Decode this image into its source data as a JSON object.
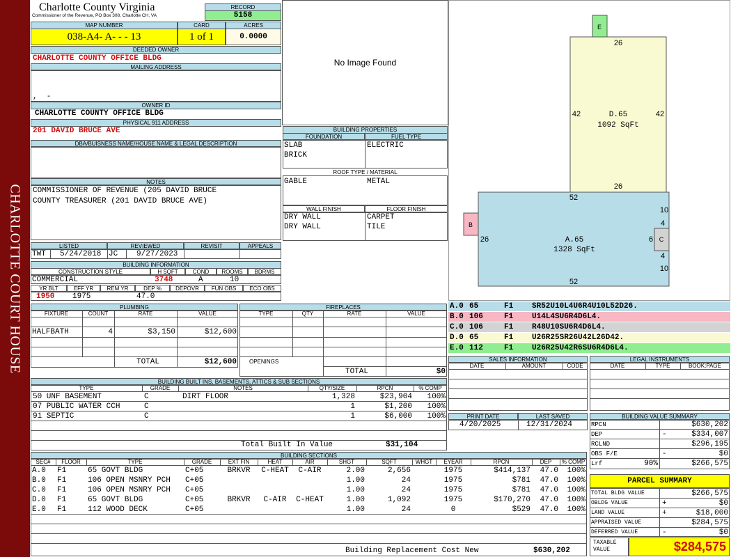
{
  "county": {
    "name": "Charlotte County Virginia",
    "address": "Commissioner of the Revenue, PO Box 308, Charlotte CH, VA",
    "sidebar": "CHARLOTTE COURT HOUSE"
  },
  "record": {
    "label": "RECORD",
    "value": "5158"
  },
  "map": {
    "label": "MAP NUMBER",
    "value": "038-A4- A-  -  - 13"
  },
  "card": {
    "label": "CARD",
    "value": "1 of 1"
  },
  "acres": {
    "label": "ACRES",
    "value": "0.0000"
  },
  "deeded": {
    "label": "DEEDED OWNER",
    "value": "CHARLOTTE COUNTY OFFICE BLDG"
  },
  "mailing": {
    "label": "MAILING ADDRESS",
    "line": ",  -"
  },
  "owner_id": {
    "label": "OWNER ID",
    "value": "CHARLOTTE COUNTY OFFICE BLDG"
  },
  "physical": {
    "label": "PHYSICAL 911 ADDRESS",
    "value": "201 DAVID BRUCE AVE"
  },
  "dba": {
    "label": "DBA/BUISNESS NAME/HOUSE NAME & LEGAL DESCRIPTION"
  },
  "notes": {
    "label": "NOTES",
    "line1": "COMMISSIONER OF REVENUE (205 DAVID BRUCE",
    "line2": "COUNTY TREASURER (201 DAVID BRUCE AVE)"
  },
  "image": {
    "text": "No Image Found"
  },
  "props": {
    "label": "BUILDING PROPERTIES",
    "foundation_label": "FOUNDATION",
    "fuel_label": "FUEL TYPE",
    "foundation": [
      "SLAB",
      "BRICK"
    ],
    "fuel": [
      "ELECTRIC"
    ],
    "roof_label": "ROOF TYPE / MATERIAL",
    "roof": [
      "GABLE",
      "METAL"
    ],
    "wall_label": "WALL FINISH",
    "floor_label": "FLOOR FINISH",
    "wall": [
      "DRY WALL",
      "DRY WALL"
    ],
    "floor": [
      "CARPET",
      "TILE"
    ]
  },
  "listed": {
    "labels": [
      "LISTED",
      "REVIEWED",
      "REVISIT",
      "APPEALS"
    ],
    "a": "TWT",
    "b": "5/24/2018",
    "c": "JC",
    "d": "9/27/2023"
  },
  "binfo": {
    "label": "BUILDING INFORMATION",
    "cs_label": "CONSTRUCTION STYLE",
    "hsqft_label": "H SQFT",
    "cond_label": "COND",
    "rooms_label": "ROOMS",
    "bdrms_label": "BDRMS",
    "style": "COMMERCIAL",
    "hsqft": "3748",
    "cond": "A",
    "rooms": "10",
    "yrblt_label": "YR BLT",
    "effyr_label": "EFF YR",
    "remyr_label": "REM YR",
    "dep_label": "DEP %",
    "depovr_label": "DEPOVR",
    "funobs_label": "FUN OBS",
    "ecoobs_label": "ECO OBS",
    "yrblt": "1950",
    "effyr": "1975",
    "dep": "47.0"
  },
  "plumb": {
    "label": "PLUMBING",
    "cols": [
      "FIXTURE",
      "COUNT",
      "RATE",
      "VALUE"
    ],
    "fixture": "HALFBATH",
    "count": "4",
    "rate": "$3,150",
    "value": "$12,600",
    "total_label": "TOTAL",
    "total": "$12,600"
  },
  "fire": {
    "label": "FIREPLACES",
    "cols": [
      "TYPE",
      "QTY",
      "RATE",
      "VALUE"
    ],
    "openings": "OPENINGS",
    "total_label": "TOTAL",
    "total": "$0"
  },
  "builtins": {
    "label": "BUILDING BUILT INS, BASEMENTS, ATTICS & SUB SECTIONS",
    "cols": [
      "TYPE",
      "GRADE",
      "NOTES",
      "QTY/SIZE",
      "RPCN",
      "% COMP"
    ],
    "rows": [
      [
        "50 UNF BASEMENT",
        "C",
        "DIRT FLOOR",
        "1,328",
        "$23,904",
        "100%"
      ],
      [
        "07 PUBLIC WATER CCH",
        "C",
        "",
        "1",
        "$1,200",
        "100%"
      ],
      [
        "91 SEPTIC",
        "C",
        "",
        "1",
        "$6,000",
        "100%"
      ]
    ],
    "total_label": "Total Built In Value",
    "total": "$31,104"
  },
  "sections": {
    "label": "BUILDING SECTIONS",
    "cols": [
      "SEC#",
      "FLOOR",
      "TYPE",
      "GRADE",
      "EXT FIN",
      "HEAT",
      "AIR",
      "SHGT",
      "SQFT",
      "WHGT",
      "EYEAR",
      "RPCN",
      "DEP",
      "% COMP"
    ],
    "rows": [
      [
        "A.0",
        "F1",
        "65 GOVT BLDG",
        "C+05",
        "BRKVR",
        "C-HEAT",
        "C-AIR",
        "2.00",
        "2,656",
        "",
        "1975",
        "$414,137",
        "47.0",
        "100%"
      ],
      [
        "B.0",
        "F1",
        "106 OPEN MSNRY PCH",
        "C+05",
        "",
        "",
        "",
        "1.00",
        "24",
        "",
        "1975",
        "$781",
        "47.0",
        "100%"
      ],
      [
        "C.0",
        "F1",
        "106 OPEN MSNRY PCH",
        "C+05",
        "",
        "",
        "",
        "1.00",
        "24",
        "",
        "1975",
        "$781",
        "47.0",
        "100%"
      ],
      [
        "D.0",
        "F1",
        "65 GOVT BLDG",
        "C+05",
        "BRKVR",
        "C-AIR",
        "C-HEAT",
        "1.00",
        "1,092",
        "",
        "1975",
        "$170,270",
        "47.0",
        "100%"
      ],
      [
        "E.0",
        "F1",
        "112 WOOD DECK",
        "C+05",
        "",
        "",
        "",
        "1.00",
        "24",
        "",
        "0",
        "$529",
        "47.0",
        "100%"
      ]
    ],
    "brcn_label": "Building Replacement Cost New",
    "brcn": "$630,202"
  },
  "sketch": {
    "E": "E",
    "B": "B",
    "C": "C",
    "D_label": "D.65",
    "D_sqft": "1092 SqFt",
    "A_label": "A.65",
    "A_sqft": "1328 SqFt",
    "d26a": "26",
    "d42l": "42",
    "d42r": "42",
    "d26b": "26",
    "d52t": "52",
    "d52b": "52",
    "d26l": "26",
    "d10a": "10",
    "d4a": "4",
    "d6": "6",
    "d4b": "4",
    "d10b": "10"
  },
  "legend": [
    {
      "sec": "A.0",
      "n": "65",
      "f": "F1",
      "path": "SR52U10L4U6R4U10L52D26.",
      "color": "#b7dde8"
    },
    {
      "sec": "B.0",
      "n": "106",
      "f": "F1",
      "path": "U14L4SU6R4D6L4.",
      "color": "#f7b7c3"
    },
    {
      "sec": "C.0",
      "n": "106",
      "f": "F1",
      "path": "R48U10SU6R4D6L4.",
      "color": "#d3d3d3"
    },
    {
      "sec": "D.0",
      "n": "65",
      "f": "F1",
      "path": "U26R25SR26U42L26D42.",
      "color": "#fafad2"
    },
    {
      "sec": "E.0",
      "n": "112",
      "f": "F1",
      "path": "U26R25U42R6SU6R4D6L4.",
      "color": "#90ee90"
    }
  ],
  "sales": {
    "label": "SALES INFORMATION",
    "cols": [
      "DATE",
      "AMOUNT",
      "CODE"
    ]
  },
  "legal": {
    "label": "LEGAL INSTRUMENTS",
    "cols": [
      "DATE",
      "TYPE",
      "BOOK:PAGE"
    ]
  },
  "print": {
    "print_label": "PRINT DATE",
    "print": "4/20/2025",
    "saved_label": "LAST SAVED",
    "saved": "12/31/2024"
  },
  "bvs": {
    "label": "BUILDING VALUE SUMMARY",
    "rpcn_l": "RPCN",
    "rpcn": "$630,202",
    "dep_l": "DEP",
    "dep_s": "-",
    "dep": "$334,007",
    "rclnd_l": "RCLND",
    "rclnd": "$296,195",
    "obs_l": "OBS F/E",
    "obs_s": "-",
    "obs": "$0",
    "lrf_l": "Lrf",
    "lrf_p": "90%",
    "lrf": "$266,575"
  },
  "parcel": {
    "label": "PARCEL SUMMARY",
    "tbv_l": "TOTAL BLDG VALUE",
    "tbv": "$266,575",
    "obldg_l": "OBLDG VALUE",
    "obldg_s": "+",
    "obldg": "$0",
    "land_l": "LAND VALUE",
    "land_s": "+",
    "land": "$18,000",
    "appr_l": "APPRAISED VALUE",
    "appr": "$284,575",
    "def_l": "DEFERRED VALUE",
    "def_s": "-",
    "def": "$0",
    "tax_l1": "TAXABLE",
    "tax_l2": "VALUE",
    "tax": "$284,575"
  }
}
